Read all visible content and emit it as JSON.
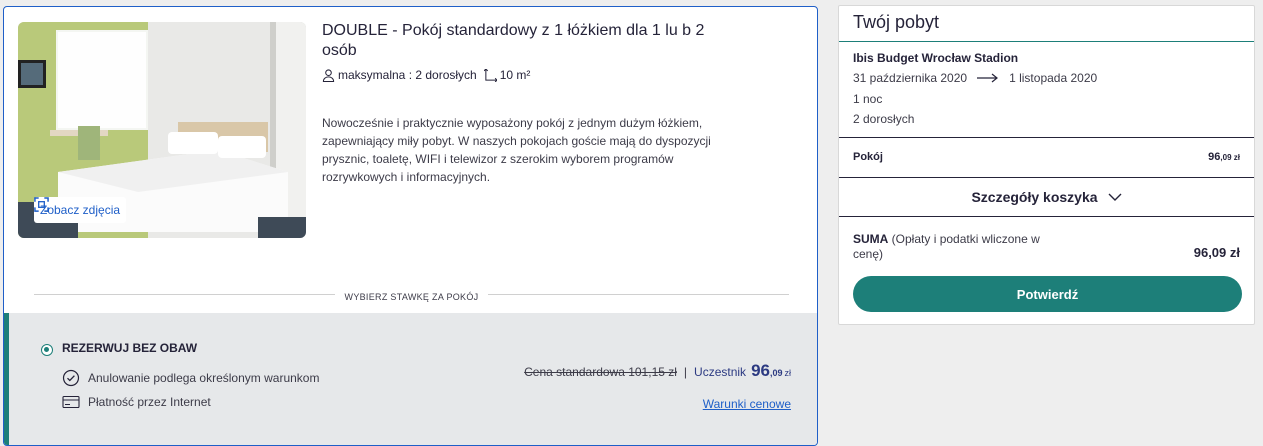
{
  "room": {
    "title": "DOUBLE - Pokój standardowy z 1 łóżkiem dla 1 lu b 2 osób",
    "photos_label": "Zobacz zdjęcia",
    "capacity": "maksymalna : 2 dorosłych",
    "area": "10 m²",
    "description": "Nowocześnie i praktycznie wyposażony pokój z jednym dużym łóżkiem, zapewniający miły pobyt. W naszych pokojach goście mają do dyspozycji prysznic, toaletę, WIFI i telewizor z szerokim wyborem programów rozrywkowych i informacyjnych."
  },
  "rates": {
    "section_label": "WYBIERZ STAWKĘ ZA POKÓJ",
    "rate_name": "REZERWUJ BEZ OBAW",
    "conditions": [
      "Anulowanie podlega określonym warunkom",
      "Płatność przez Internet"
    ],
    "standard_price": "Cena standardowa 101,15 zł",
    "separator": "|",
    "member_label": "Uczestnik",
    "member_price_main": "96",
    "member_price_decimals": ",09",
    "currency": "zł",
    "terms_link": "Warunki cenowe"
  },
  "basket": {
    "title": "Twój pobyt",
    "hotel": "Ibis Budget Wrocław Stadion",
    "date_from": "31 października 2020",
    "date_to": "1 listopada 2020",
    "nights": "1 noc",
    "guests": "2 dorosłych",
    "room_label": "Pokój",
    "room_price_main": "96",
    "room_price_small": ",09 zł",
    "details_label": "Szczegóły koszyka",
    "sum_label": "SUMA",
    "sum_note": " (Opłaty i podatki wliczone w cenę)",
    "sum_value": "96,09 zł",
    "confirm_label": "Potwierdź"
  },
  "colors": {
    "accent_teal": "#1d7f79",
    "link_blue": "#1f5fc8",
    "price_navy": "#2c3a82"
  }
}
